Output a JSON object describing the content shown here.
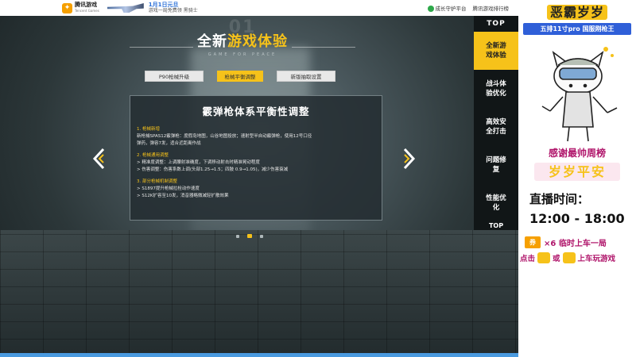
{
  "header": {
    "logo_text": "腾讯游戏",
    "logo_sub": "Tencent Games",
    "promo_title": "1月1日元旦",
    "promo_sub": "游戏一局免费领 黑骑士",
    "links": [
      "成长守护平台",
      "腾讯游戏排行榜"
    ]
  },
  "section": {
    "number": "01",
    "title_part1": "全新",
    "title_part2": "游戏体验",
    "subtitle": "GAME FOR PEACE"
  },
  "tabs": [
    {
      "label": "P90枪械升级",
      "active": false
    },
    {
      "label": "枪械平衡调整",
      "active": true
    },
    {
      "label": "新版抽取设置",
      "active": false
    }
  ],
  "panel": {
    "title": "霰弹枪体系平衡性调整",
    "sections": [
      {
        "heading": "1. 枪械新增",
        "lines": [
          "新枪械SPAS12霰弹枪：度假岛地图，山谷地图投放；速射型半自动霰弹枪，使用12号口径",
          "弹药，弹容7发，适合近距离作战"
        ]
      },
      {
        "heading": "2. 枪械通用调整",
        "lines": [
          "> 精准度调整：上调腰射准确度，下调移动射击时精准晃动程度",
          "> 伤害调整：伤害系数上调(头部1.25→1.5；四肢 0.9→1.05)，减少伤害衰减"
        ]
      },
      {
        "heading": "3. 部分枪械机制调整",
        "lines": [
          "> S1897提升枪械拉栓动作速度",
          "> S12K扩容至10发，消音器略微减轻扩散效果"
        ]
      }
    ]
  },
  "carousel": {
    "dots": 3,
    "active_index": 1
  },
  "rightnav": {
    "top_label": "TOP",
    "items": [
      {
        "label": "全新游戏体验",
        "active": true
      },
      {
        "label": "战斗体验优化",
        "active": false
      },
      {
        "label": "高效安全打击",
        "active": false
      },
      {
        "label": "问题修复",
        "active": false
      },
      {
        "label": "性能优化",
        "active": false
      }
    ],
    "bottom_label": "TOP"
  },
  "overlay": {
    "streamer_name": "恶霸岁岁",
    "sponsor": "五排11寸pro 国服刚枪王",
    "thanks": "感谢最帅周榜",
    "blessing": "岁岁平安",
    "live_label": "直播时间：",
    "live_time": "12:00 - 18:00",
    "ticket_icon": "券",
    "ticket_text": "×6 临时上车一局",
    "click_prefix": "点击",
    "click_or": "或",
    "click_suffix": "上车玩游戏"
  },
  "colors": {
    "accent": "#f6c21a",
    "nav_bg": "#111617",
    "link_blue": "#2a6fd8",
    "overlay_pink": "#b0166b"
  }
}
